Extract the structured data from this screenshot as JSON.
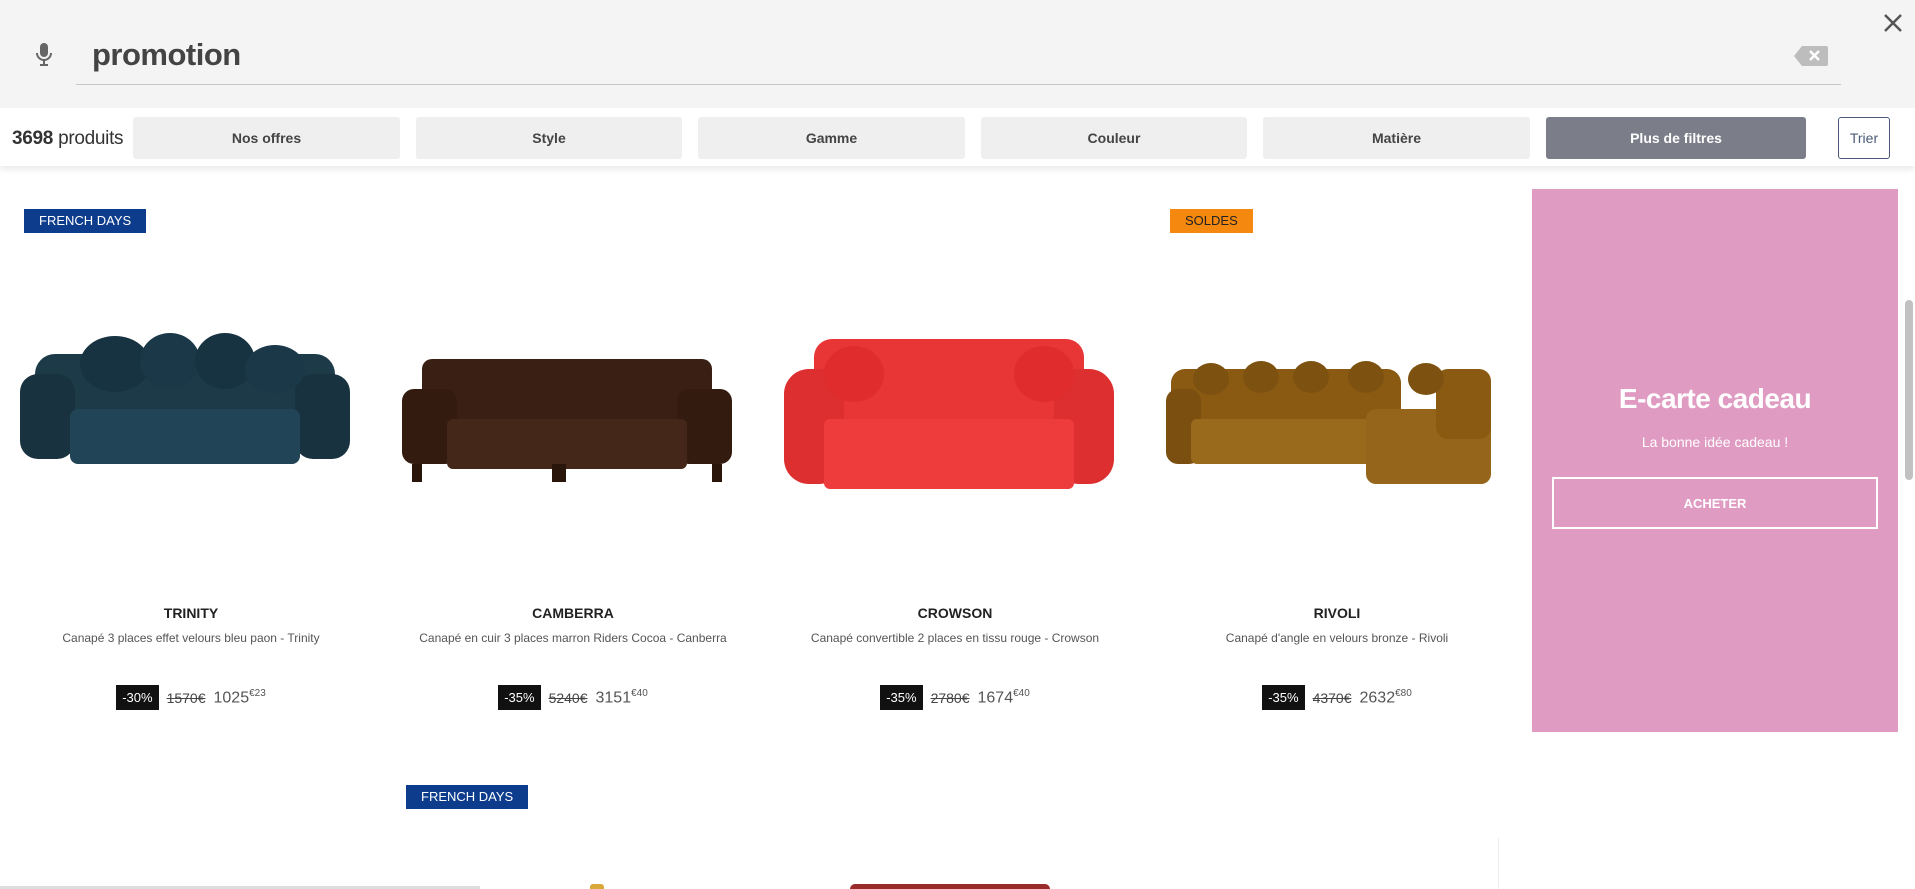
{
  "search": {
    "query": "promotion"
  },
  "filters": {
    "count_number": "3698",
    "count_label": "produits",
    "items": [
      "Nos offres",
      "Style",
      "Gamme",
      "Couleur",
      "Matière",
      "Plus de filtres"
    ],
    "sort_label": "Trier"
  },
  "products": [
    {
      "badge": "FRENCH DAYS",
      "name": "TRINITY",
      "desc": "Canapé 3 places effet velours bleu paon - Trinity",
      "discount": "-30%",
      "old_price": "1570€",
      "new_price": "1025",
      "new_cents": "€23",
      "color": "#1c3a48"
    },
    {
      "badge": "",
      "name": "CAMBERRA",
      "desc": "Canapé en cuir 3 places marron Riders Cocoa - Canberra",
      "discount": "-35%",
      "old_price": "5240€",
      "new_price": "3151",
      "new_cents": "€40",
      "color": "#3a2014"
    },
    {
      "badge": "",
      "name": "CROWSON",
      "desc": "Canapé convertible 2 places en tissu rouge - Crowson",
      "discount": "-35%",
      "old_price": "2780€",
      "new_price": "1674",
      "new_cents": "€40",
      "color": "#e83535"
    },
    {
      "badge": "SOLDES",
      "name": "RIVOLI",
      "desc": "Canapé d'angle en velours bronze - Rivoli",
      "discount": "-35%",
      "old_price": "4370€",
      "new_price": "2632",
      "new_cents": "€80",
      "color": "#8a5a12"
    }
  ],
  "gift": {
    "title": "E-carte cadeau",
    "subtitle": "La bonne idée cadeau !",
    "button": "ACHETER"
  },
  "second_row": {
    "badge": "FRENCH DAYS"
  },
  "colors": {
    "badge_blue": "#0d3c8c",
    "badge_orange": "#f5880e",
    "gift_bg": "#e09bc2",
    "filter_dark": "#7b7d88"
  }
}
